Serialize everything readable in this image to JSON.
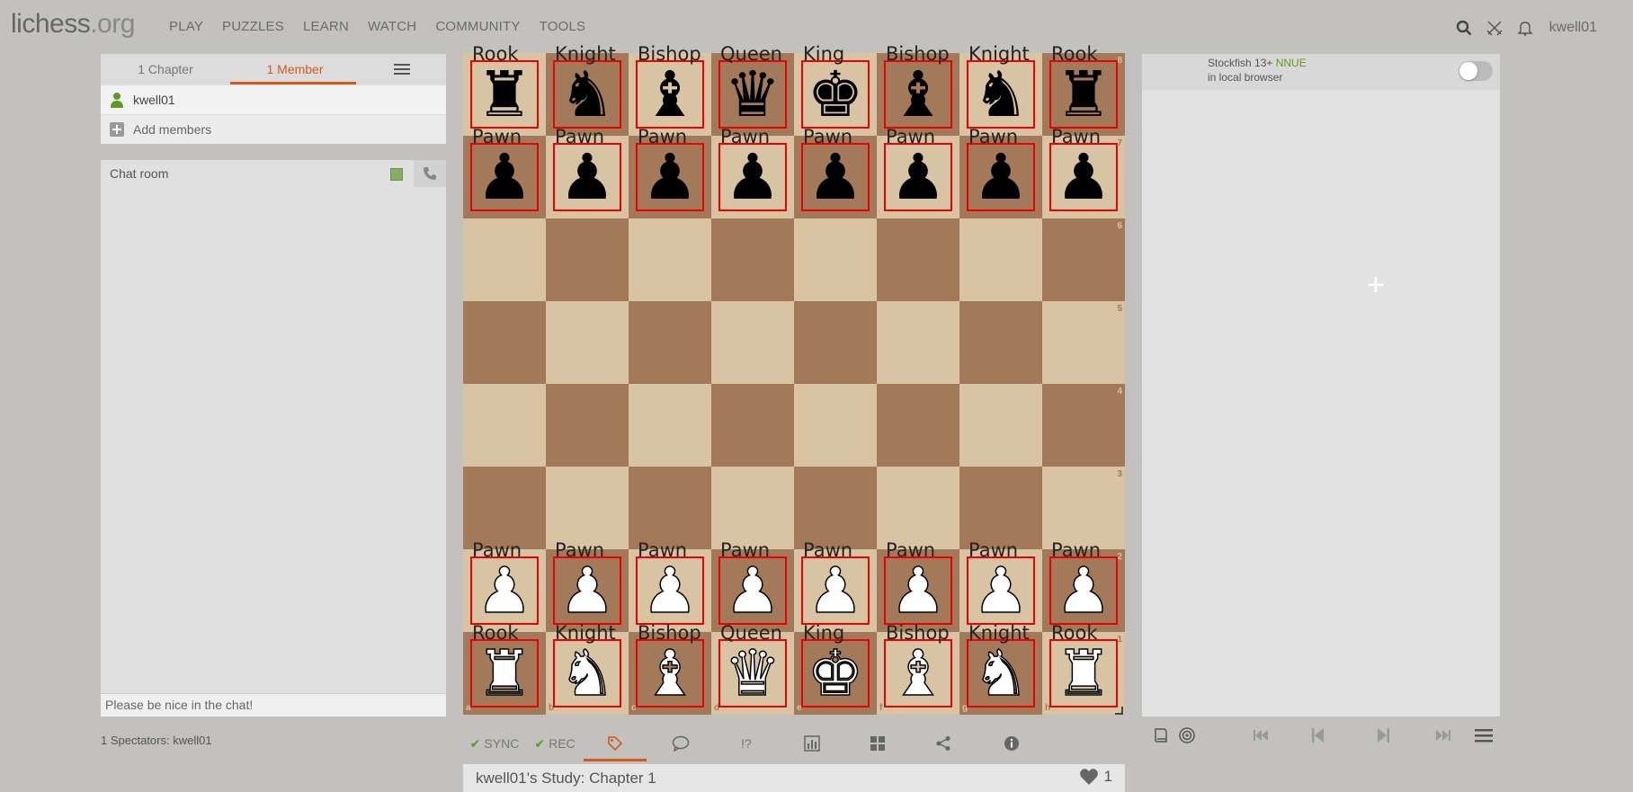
{
  "header": {
    "logo": "lichess",
    "logo_tld": ".org",
    "menu": [
      "PLAY",
      "PUZZLES",
      "LEARN",
      "WATCH",
      "COMMUNITY",
      "TOOLS"
    ],
    "username": "kwell01"
  },
  "members": {
    "tab_chapters": "1 Chapter",
    "tab_members": "1 Member",
    "member_name": "kwell01",
    "add_label": "Add members"
  },
  "chat": {
    "title": "Chat room",
    "placeholder": "Please be nice in the chat!"
  },
  "spectators": "1 Spectators: kwell01",
  "board": {
    "files": [
      "a",
      "b",
      "c",
      "d",
      "e",
      "f",
      "g",
      "h"
    ],
    "ranks": [
      "8",
      "7",
      "6",
      "5",
      "4",
      "3",
      "2",
      "1"
    ],
    "colors": {
      "light": "#d8c3a3",
      "dark": "#a27a5a"
    },
    "pieces": [
      [
        "Rook",
        "Knight",
        "Bishop",
        "Queen",
        "King",
        "Bishop",
        "Knight",
        "Rook"
      ],
      [
        "Pawn",
        "Pawn",
        "Pawn",
        "Pawn",
        "Pawn",
        "Pawn",
        "Pawn",
        "Pawn"
      ],
      [],
      [],
      [],
      [],
      [
        "Pawn",
        "Pawn",
        "Pawn",
        "Pawn",
        "Pawn",
        "Pawn",
        "Pawn",
        "Pawn"
      ],
      [
        "Rook",
        "Knight",
        "Bishop",
        "Queen",
        "King",
        "Bishop",
        "Knight",
        "Rook"
      ]
    ]
  },
  "tools": {
    "sync": "SYNC",
    "rec": "REC",
    "comment_glyph": "!?"
  },
  "study": {
    "title": "kwell01's Study: Chapter 1",
    "likes": "1"
  },
  "engine": {
    "name": "Stockfish 13+",
    "badge": "NNUE",
    "sub": "in local browser",
    "plus": "+"
  },
  "accent": "#d45a1c",
  "green": "#629924"
}
